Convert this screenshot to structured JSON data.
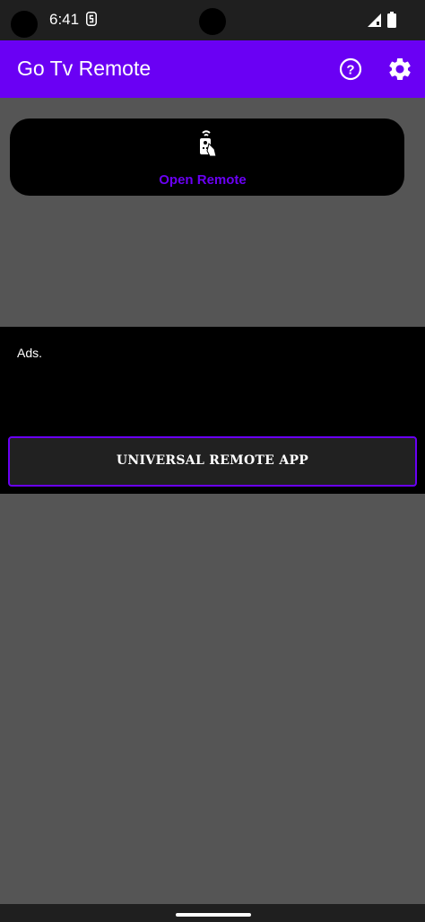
{
  "status_bar": {
    "time": "6:41",
    "icons": [
      "notification-s-icon",
      "signal-icon",
      "battery-icon"
    ]
  },
  "app_bar": {
    "title": "Go Tv Remote",
    "actions": [
      {
        "name": "help-icon",
        "label": "?"
      },
      {
        "name": "settings-gear-icon"
      }
    ]
  },
  "main": {
    "open_remote_label": "Open Remote",
    "open_remote_icon": "remote-control-icon"
  },
  "ads": {
    "label": "Ads.",
    "button_label": "UNIVERSAL REMOTE APP"
  },
  "colors": {
    "accent": "#6a00f4",
    "background": "#555555",
    "card": "#000000",
    "status_bar": "#1f1f1f"
  }
}
